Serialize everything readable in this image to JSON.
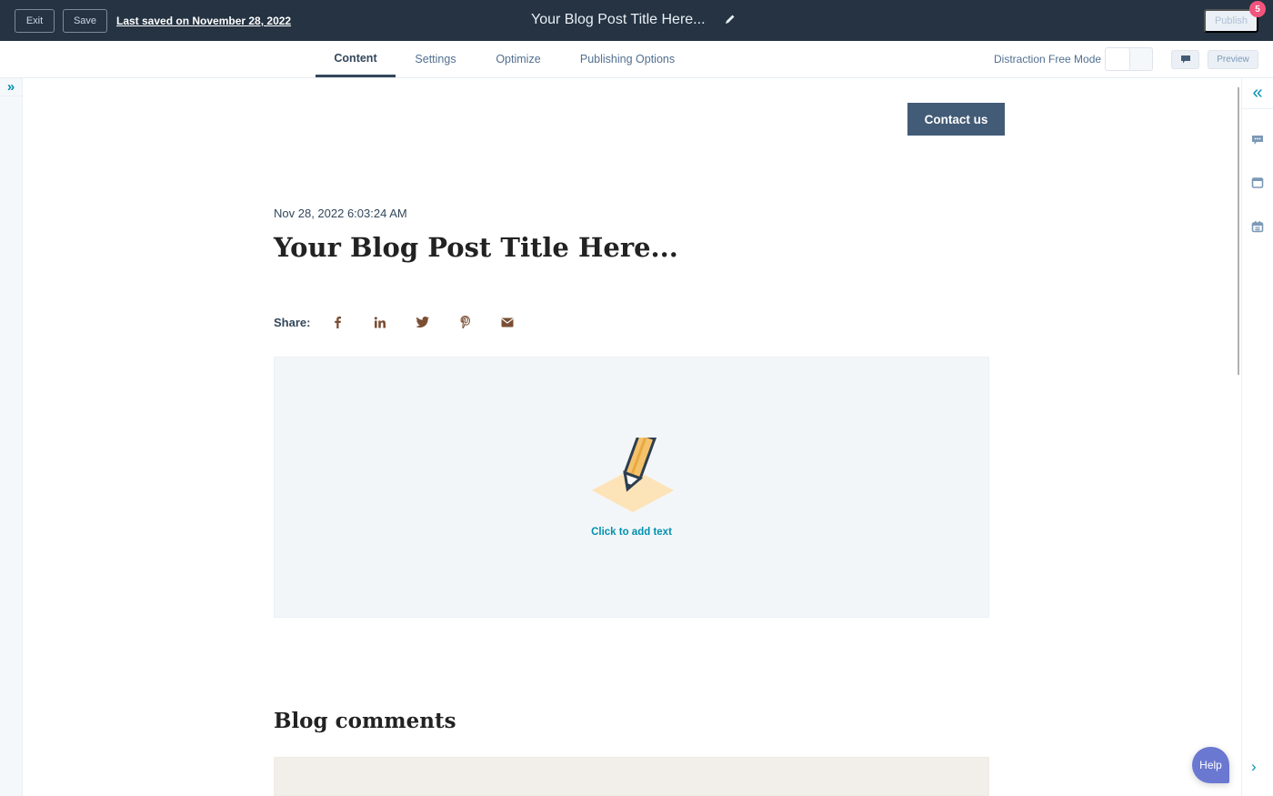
{
  "topbar": {
    "exit_label": "Exit",
    "save_label": "Save",
    "last_saved": "Last saved on November 28, 2022",
    "doc_title": "Your Blog Post Title Here...",
    "publish_label": "Publish",
    "notification_count": "5"
  },
  "tabs": [
    {
      "label": "Content",
      "active": true
    },
    {
      "label": "Settings",
      "active": false
    },
    {
      "label": "Optimize",
      "active": false
    },
    {
      "label": "Publishing Options",
      "active": false
    }
  ],
  "toolbar": {
    "distraction_free_label": "Distraction Free Mode",
    "distraction_free_on": false,
    "preview_label": "Preview"
  },
  "left_rail": {
    "expand_icon": "»"
  },
  "right_rail": {
    "collapse_icon": "«",
    "icons": [
      "comment-icon",
      "layout-icon",
      "calendar-icon"
    ],
    "chevron": "›"
  },
  "page": {
    "contact_button": "Contact us",
    "post_date": "Nov 28, 2022 6:03:24 AM",
    "post_title": "Your Blog Post Title Here...",
    "share_label": "Share:",
    "share_icons": [
      {
        "name": "facebook-icon",
        "glyph": "f"
      },
      {
        "name": "linkedin-icon",
        "glyph": "in"
      },
      {
        "name": "twitter-icon",
        "glyph": "twitter"
      },
      {
        "name": "pinterest-icon",
        "glyph": "p"
      },
      {
        "name": "email-icon",
        "glyph": "envelope"
      }
    ],
    "rich_text_placeholder": "Click to add text",
    "comments_heading": "Blog comments"
  },
  "help_label": "Help",
  "colors": {
    "topbar_bg": "#253342",
    "accent": "#0091ae",
    "contact_bg": "#425b76",
    "share_icon": "#7a4e33",
    "help_bg": "#6a78d1",
    "badge": "#f2547d"
  }
}
